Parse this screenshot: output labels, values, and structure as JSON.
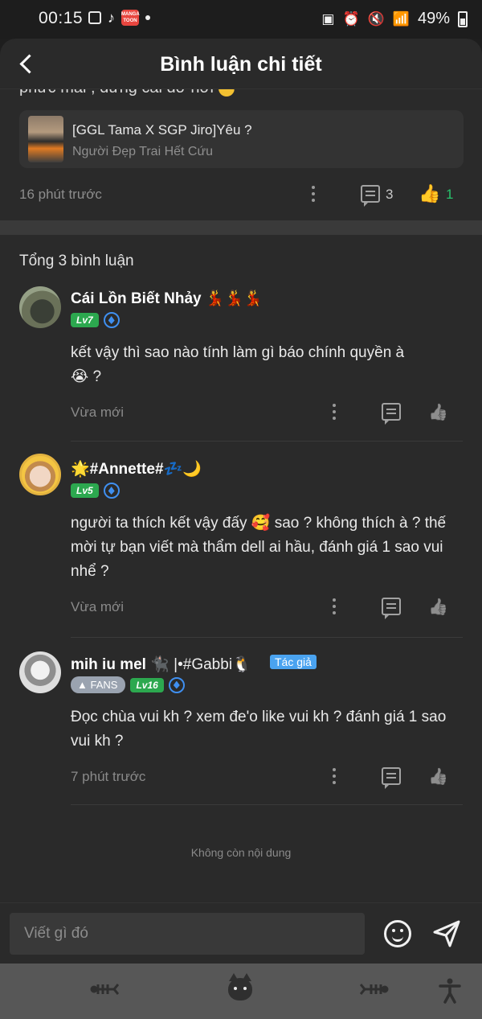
{
  "status_bar": {
    "time": "00:15",
    "manga_badge": "MANGA TOON",
    "battery": "49%"
  },
  "header": {
    "title": "Bình luận chi tiết"
  },
  "parent_comment": {
    "cut_off_text": "phức mãi , đừng cãi dở hơi",
    "story_title": "[GGL Tama X SGP Jiro]Yêu ?",
    "story_author": "Người Đẹp Trai Hết Cứu",
    "time": "16 phút trước",
    "reply_count": "3",
    "like_count": "1",
    "like_color": "#27c26c"
  },
  "comments_section": {
    "total_label": "Tổng 3 bình luận",
    "no_more_label": "Không còn nội dung",
    "items": [
      {
        "name": "Cái Lồn Biết Nhảy",
        "name_emoji": "💃💃💃",
        "level": "Lv7",
        "text": "kết vậy thì sao nào tính làm gì báo chính quyền à",
        "text_tail": "😭 ?",
        "time": "Vừa mới"
      },
      {
        "name": "🌟#Annette#",
        "name_emoji": "💤🌙",
        "level": "Lv5",
        "text": "người ta thích kết vậy đấy 🥰 sao ? không thích à ? thế mời tự bạn viết mà thẩm dell ai hầu, đánh giá 1 sao vui nhể ?",
        "time": "Vừa mới"
      },
      {
        "name": "mih iu mel",
        "name_emoji": "🐈‍⬛ |•#Gabbi🐧",
        "author_tag": "Tác giả",
        "fans_badge": "FANS",
        "level": "Lv16",
        "text": "Đọc chùa vui kh ? xem đe'o like vui kh ? đánh giá 1 sao vui kh ?",
        "time": "7 phút trước"
      }
    ]
  },
  "input_bar": {
    "placeholder": "Viết gì đó"
  },
  "icons": {
    "back": "chevron-left-icon",
    "reply": "chat-bubble-icon",
    "like": "thumbs-up-icon",
    "more": "kebab-menu-icon",
    "emoji": "smiley-icon",
    "send": "paper-plane-icon",
    "nav_fish": "fish-bone-icon",
    "nav_cat": "cat-face-icon",
    "accessibility": "accessibility-icon"
  }
}
